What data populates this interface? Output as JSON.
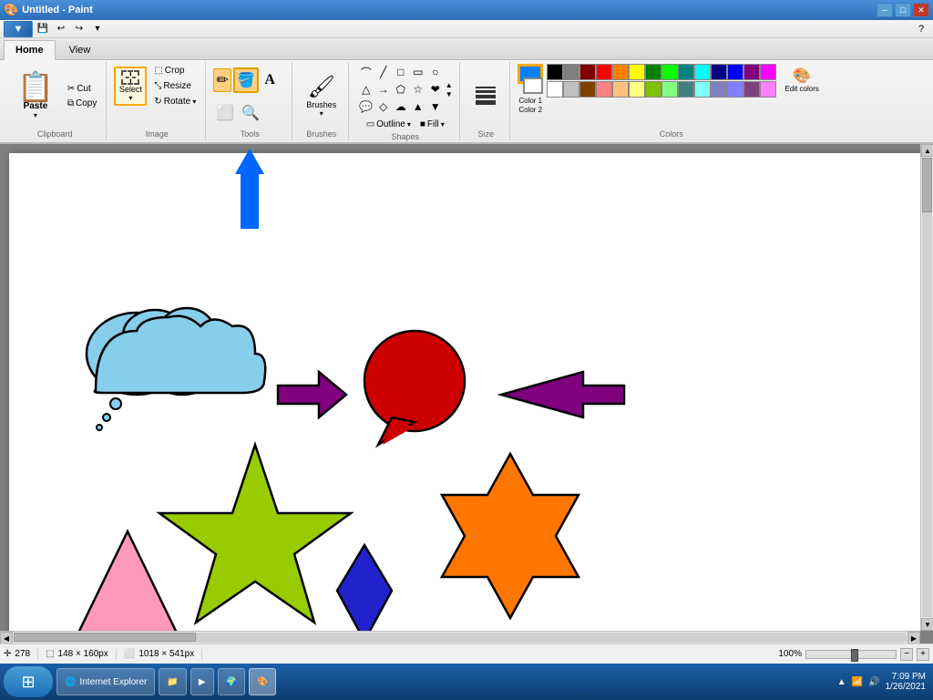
{
  "titleBar": {
    "title": "Untitled - Paint",
    "controls": [
      "minimize",
      "maximize",
      "close"
    ]
  },
  "quickAccess": {
    "buttons": [
      "save",
      "undo",
      "redo",
      "dropdown"
    ]
  },
  "ribbon": {
    "tabs": [
      "Home",
      "View"
    ],
    "activeTab": "Home",
    "groups": {
      "clipboard": {
        "label": "Clipboard",
        "paste": "Paste",
        "cut": "Cut",
        "copy": "Copy"
      },
      "image": {
        "label": "Image",
        "select": "Select",
        "crop": "Crop",
        "resize": "Resize",
        "rotate": "Rotate"
      },
      "tools": {
        "pencil": "✏",
        "fill": "⬛",
        "text": "A",
        "eraser": "⬜",
        "picker": "🔍"
      },
      "brushes": {
        "label": "Brushes",
        "name": "Brushes"
      },
      "shapes": {
        "label": "Shapes",
        "items": [
          "~",
          "⌒",
          "□",
          "▱",
          "◇",
          "○",
          "△",
          "▷",
          "☆",
          "⬠",
          "❤",
          "✦",
          "→",
          "⇒",
          "⭐"
        ]
      },
      "sizeOutline": {
        "outlineLabel": "Outline",
        "fillLabel": "Fill",
        "sizeLabel": "Size"
      },
      "colors": {
        "label": "Colors",
        "color1Label": "Color 1",
        "color2Label": "Color 2",
        "editLabel": "Edit colors",
        "selectedColor": "#0080ff",
        "color2": "#ffffff",
        "palette": [
          "#000000",
          "#808080",
          "#800000",
          "#ff0000",
          "#ff8000",
          "#ffff00",
          "#008000",
          "#00ff00",
          "#008080",
          "#00ffff",
          "#000080",
          "#0000ff",
          "#800080",
          "#ff00ff",
          "#ffffff",
          "#c0c0c0",
          "#804000",
          "#ff8080",
          "#ffc080",
          "#ffff80",
          "#80c000",
          "#80ff80",
          "#408080",
          "#80ffff",
          "#8080c0",
          "#8080ff",
          "#804080",
          "#ff80ff"
        ]
      }
    }
  },
  "canvas": {
    "width": "1018 × 541px",
    "zoom": "100%"
  },
  "statusBar": {
    "coords": "278",
    "sizeDisplay": "148 × 160px",
    "canvasSize": "1018 × 541px",
    "zoom": "100%"
  },
  "taskbar": {
    "startLabel": "⊞",
    "items": [
      {
        "label": "Internet Explorer",
        "icon": "🌐"
      },
      {
        "label": "📁"
      },
      {
        "label": "▶"
      },
      {
        "label": "🌍"
      },
      {
        "label": "🎨"
      }
    ],
    "systemTray": {
      "time": "7:09 PM",
      "date": "1/26/2021"
    }
  }
}
